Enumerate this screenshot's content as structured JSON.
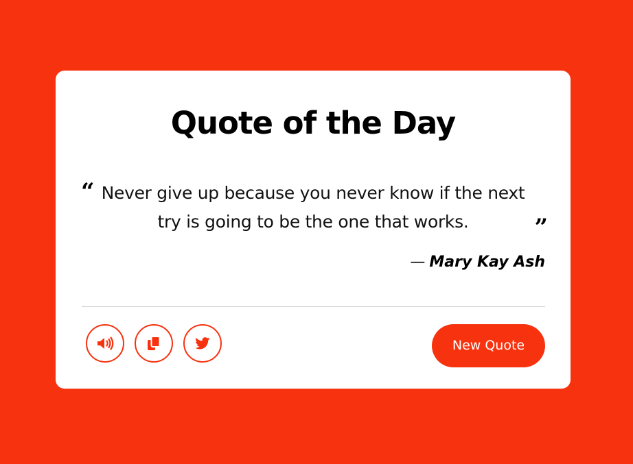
{
  "app": {
    "background_color": "#f7320f",
    "accent_color": "#f7320f"
  },
  "card": {
    "title": "Quote of the Day",
    "quote": {
      "text": "Never give up because you never know if the next try is going to be the one that works.",
      "open_mark": "“",
      "close_mark": "”"
    },
    "author": {
      "dash": "—",
      "name": "Mary Kay Ash"
    },
    "actions": {
      "speak_icon": "volume-icon",
      "copy_icon": "copy-icon",
      "twitter_icon": "twitter-icon",
      "new_quote_label": "New Quote"
    }
  }
}
